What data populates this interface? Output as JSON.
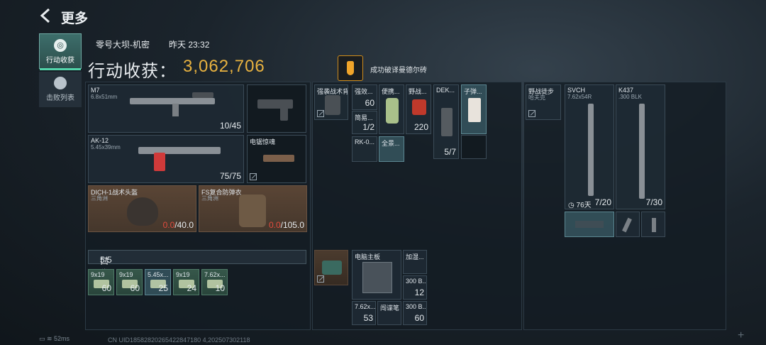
{
  "header": {
    "title": "更多"
  },
  "nav": [
    {
      "label": "行动收获",
      "icon": "loot-icon",
      "active": true
    },
    {
      "label": "击败列表",
      "icon": "skull-icon",
      "active": false
    }
  ],
  "match": {
    "map": "零号大坝-机密",
    "time": "昨天 23:32"
  },
  "harvest": {
    "label": "行动收获：",
    "value": "3,062,706"
  },
  "achievement": {
    "text": "成功破译曼德尔砖",
    "icon": "brick-icon"
  },
  "weapons": [
    {
      "name": "M7",
      "caliber": "6.8x51mm",
      "ammo": "10/45"
    },
    {
      "name": "",
      "caliber": "",
      "ammo": ""
    },
    {
      "name": "AK-12",
      "caliber": "5.45x39mm",
      "ammo": "75/75"
    },
    {
      "name": "电锯惊魂",
      "caliber": "",
      "ammo": ""
    }
  ],
  "armor": [
    {
      "name": "DICH-1战术头盔",
      "sub": "三角洲",
      "cur": "0.0",
      "max": "/40.0"
    },
    {
      "name": "FS复合防弹衣",
      "sub": "三角洲",
      "cur": "0.0",
      "max": "/105.0"
    }
  ],
  "pocket": {
    "label": "口袋：",
    "count": "5/5",
    "items": [
      {
        "name": "9x19",
        "count": "60"
      },
      {
        "name": "9x19",
        "count": "60"
      },
      {
        "name": "5.45x...",
        "count": "25"
      },
      {
        "name": "9x19",
        "count": "24"
      },
      {
        "name": "7.62x...",
        "count": "10"
      }
    ]
  },
  "rig": {
    "name": "强袭战术背心",
    "items": [
      {
        "name": "强效...",
        "count": "60"
      },
      {
        "name": "便携...",
        "count": ""
      },
      {
        "name": "野战...",
        "count": "220"
      },
      {
        "name": "DEK...",
        "count": "5/7"
      },
      {
        "name": "子弹...",
        "count": ""
      },
      {
        "name": "简易...",
        "count": "1/2"
      },
      {
        "name": "RK-0...",
        "count": ""
      },
      {
        "name": "全景...",
        "count": ""
      }
    ]
  },
  "backpack": {
    "items": [
      {
        "name": "电脑主板",
        "count": ""
      },
      {
        "name": "加湿...",
        "count": ""
      },
      {
        "name": "300 B...",
        "count": "12"
      },
      {
        "name": "7.62x...",
        "count": "53"
      },
      {
        "name": "闯谍笔",
        "count": ""
      },
      {
        "name": "300 B...",
        "count": "60"
      }
    ]
  },
  "right": {
    "bag": {
      "name": "野战徒步",
      "sub": "哈夫克"
    },
    "guns": [
      {
        "name": "SVCH",
        "caliber": "7.62x54R",
        "ammo": "7/20",
        "timer": "76天"
      },
      {
        "name": "K437",
        "caliber": ".300 BLK",
        "ammo": "7/30"
      }
    ]
  },
  "footer": {
    "ping": "52ms",
    "uid": "CN UID18582820265422847180 4,202507302118"
  }
}
